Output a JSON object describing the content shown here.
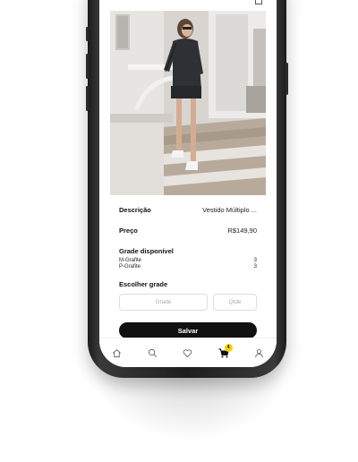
{
  "product": {
    "description_label": "Descrição",
    "description_value": "Vestido Múltiplo ...",
    "price_label": "Preço",
    "price_value": "R$149,90"
  },
  "grade": {
    "title": "Grade disponível",
    "items": [
      {
        "name": "M-Grafite",
        "qty": "3"
      },
      {
        "name": "P-Grafite",
        "qty": "3"
      }
    ]
  },
  "choose": {
    "title": "Escolher grade",
    "grade_placeholder": "Grade",
    "qty_placeholder": "Qtde"
  },
  "actions": {
    "save_label": "Salvar"
  },
  "tabbar": {
    "items": [
      {
        "icon": "home-icon"
      },
      {
        "icon": "search-icon"
      },
      {
        "icon": "heart-icon"
      },
      {
        "icon": "cart-icon",
        "badge": "4"
      },
      {
        "icon": "user-icon"
      }
    ]
  },
  "colors": {
    "badge": "#f2d400",
    "button": "#111111"
  }
}
